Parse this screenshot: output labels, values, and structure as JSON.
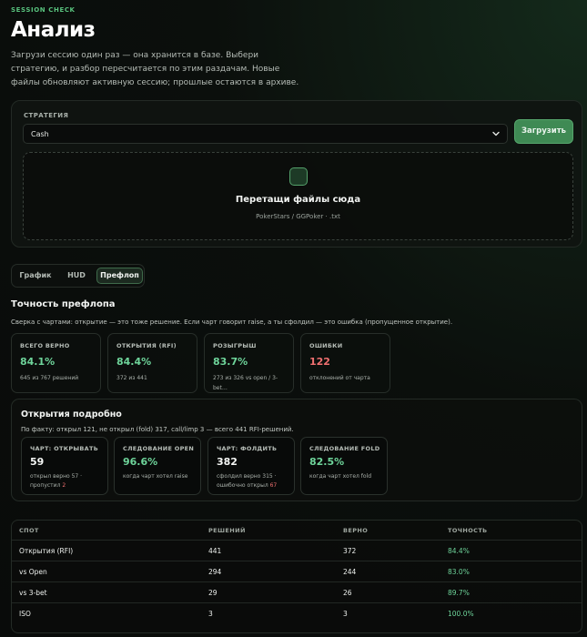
{
  "header": {
    "eyebrow": "SESSION CHECK",
    "title": "Анализ",
    "subtitle": "Загрузи сессию один раз — она хранится в базе. Выбери стратегию, и разбор пересчитается по этим раздачам. Новые файлы обновляют активную сессию; прошлые остаются в архиве."
  },
  "upload": {
    "strategy_label": "СТРАТЕГИЯ",
    "strategy_value": "Cash",
    "upload_button": "Загрузить",
    "dropzone_title": "Перетащи файлы сюда",
    "dropzone_hint": "PokerStars / GGPoker · .txt"
  },
  "tabs": [
    {
      "label": "График",
      "active": false
    },
    {
      "label": "HUD",
      "active": false
    },
    {
      "label": "Префлоп",
      "active": true
    }
  ],
  "accuracy": {
    "title": "Точность префлопа",
    "subtitle": "Сверка с чартами: открытие — это тоже решение. Если чарт говорит raise, а ты сфолдил — это ошибка (пропущенное открытие).",
    "cards": [
      {
        "label": "ВСЕГО ВЕРНО",
        "value": "84.1%",
        "note": "645 из 767 решений"
      },
      {
        "label": "ОТКРЫТИЯ (RFI)",
        "value": "84.4%",
        "note": "372 из 441"
      },
      {
        "label": "РОЗЫГРЫШ",
        "value": "83.7%",
        "note": "273 из 326 vs open / 3-bet…"
      },
      {
        "label": "ОШИБКИ",
        "value": "122",
        "note": "отклонений от чарта"
      }
    ]
  },
  "openings": {
    "title": "Открытия подробно",
    "subtitle": "По факту: открыл 121, не открыл (fold) 317, call/limp 3 — всего 441 RFI-решений.",
    "cards": [
      {
        "label": "ЧАРТ: ОТКРЫВАТЬ",
        "value": "59",
        "note": "открыл верно 57 · пропустил",
        "note_highlight": "2"
      },
      {
        "label": "СЛЕДОВАНИЕ OPEN",
        "value": "96.6%",
        "note": "когда чарт хотел raise",
        "note_highlight": ""
      },
      {
        "label": "ЧАРТ: ФОЛДИТЬ",
        "value": "382",
        "note": "сфолдил верно 315 · ошибочно открыл",
        "note_highlight": "67"
      },
      {
        "label": "СЛЕДОВАНИЕ FOLD",
        "value": "82.5%",
        "note": "когда чарт хотел fold",
        "note_highlight": ""
      }
    ]
  },
  "table": {
    "headers": [
      "СПОТ",
      "РЕШЕНИЙ",
      "ВЕРНО",
      "ТОЧНОСТЬ"
    ],
    "rows": [
      {
        "spot": "Открытия (RFI)",
        "decisions": "441",
        "correct": "372",
        "accuracy": "84.4%"
      },
      {
        "spot": "vs Open",
        "decisions": "294",
        "correct": "244",
        "accuracy": "83.0%"
      },
      {
        "spot": "vs 3-bet",
        "decisions": "29",
        "correct": "26",
        "accuracy": "89.7%"
      },
      {
        "spot": "ISO",
        "decisions": "3",
        "correct": "3",
        "accuracy": "100.0%"
      }
    ]
  },
  "colors": {
    "accent_green": "#6ed49a",
    "error_red": "#f07070",
    "button_green": "#3f8a54"
  }
}
